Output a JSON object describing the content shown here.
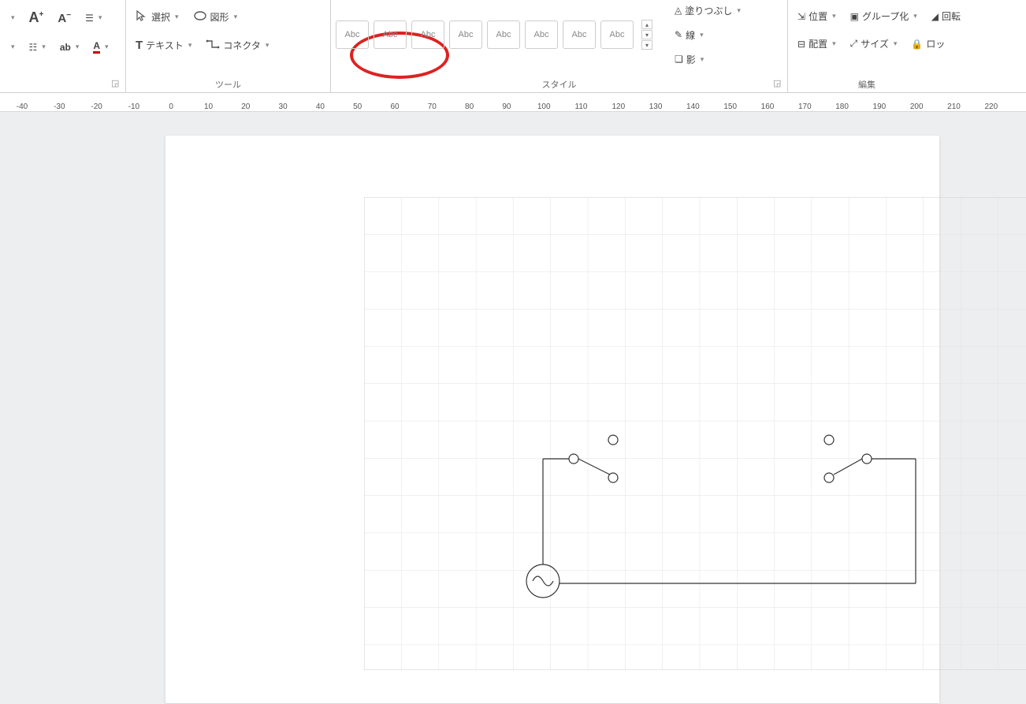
{
  "ribbon": {
    "font": {
      "increase": "A",
      "increase_sup": "+",
      "decrease": "A",
      "decrease_sup": "−",
      "textformat": "ab",
      "fontcolor": "A"
    },
    "tools": {
      "select": "選択",
      "shape": "図形",
      "text": "テキスト",
      "connector": "コネクタ",
      "group_label": "ツール"
    },
    "style": {
      "item": "Abc",
      "group_label": "スタイル"
    },
    "shapeformat": {
      "fill": "塗りつぶし",
      "line": "線",
      "shadow": "影"
    },
    "edit": {
      "position": "位置",
      "align": "配置",
      "group": "グループ化",
      "size": "サイズ",
      "rotate": "回転",
      "lock": "ロッ",
      "group_label": "編集"
    }
  },
  "ruler": {
    "ticks": [
      "-40",
      "-30",
      "-20",
      "-10",
      "0",
      "10",
      "20",
      "30",
      "40",
      "50",
      "60",
      "70",
      "80",
      "90",
      "100",
      "110",
      "120",
      "130",
      "140",
      "150",
      "160",
      "170",
      "180",
      "190",
      "200",
      "210",
      "220"
    ]
  }
}
